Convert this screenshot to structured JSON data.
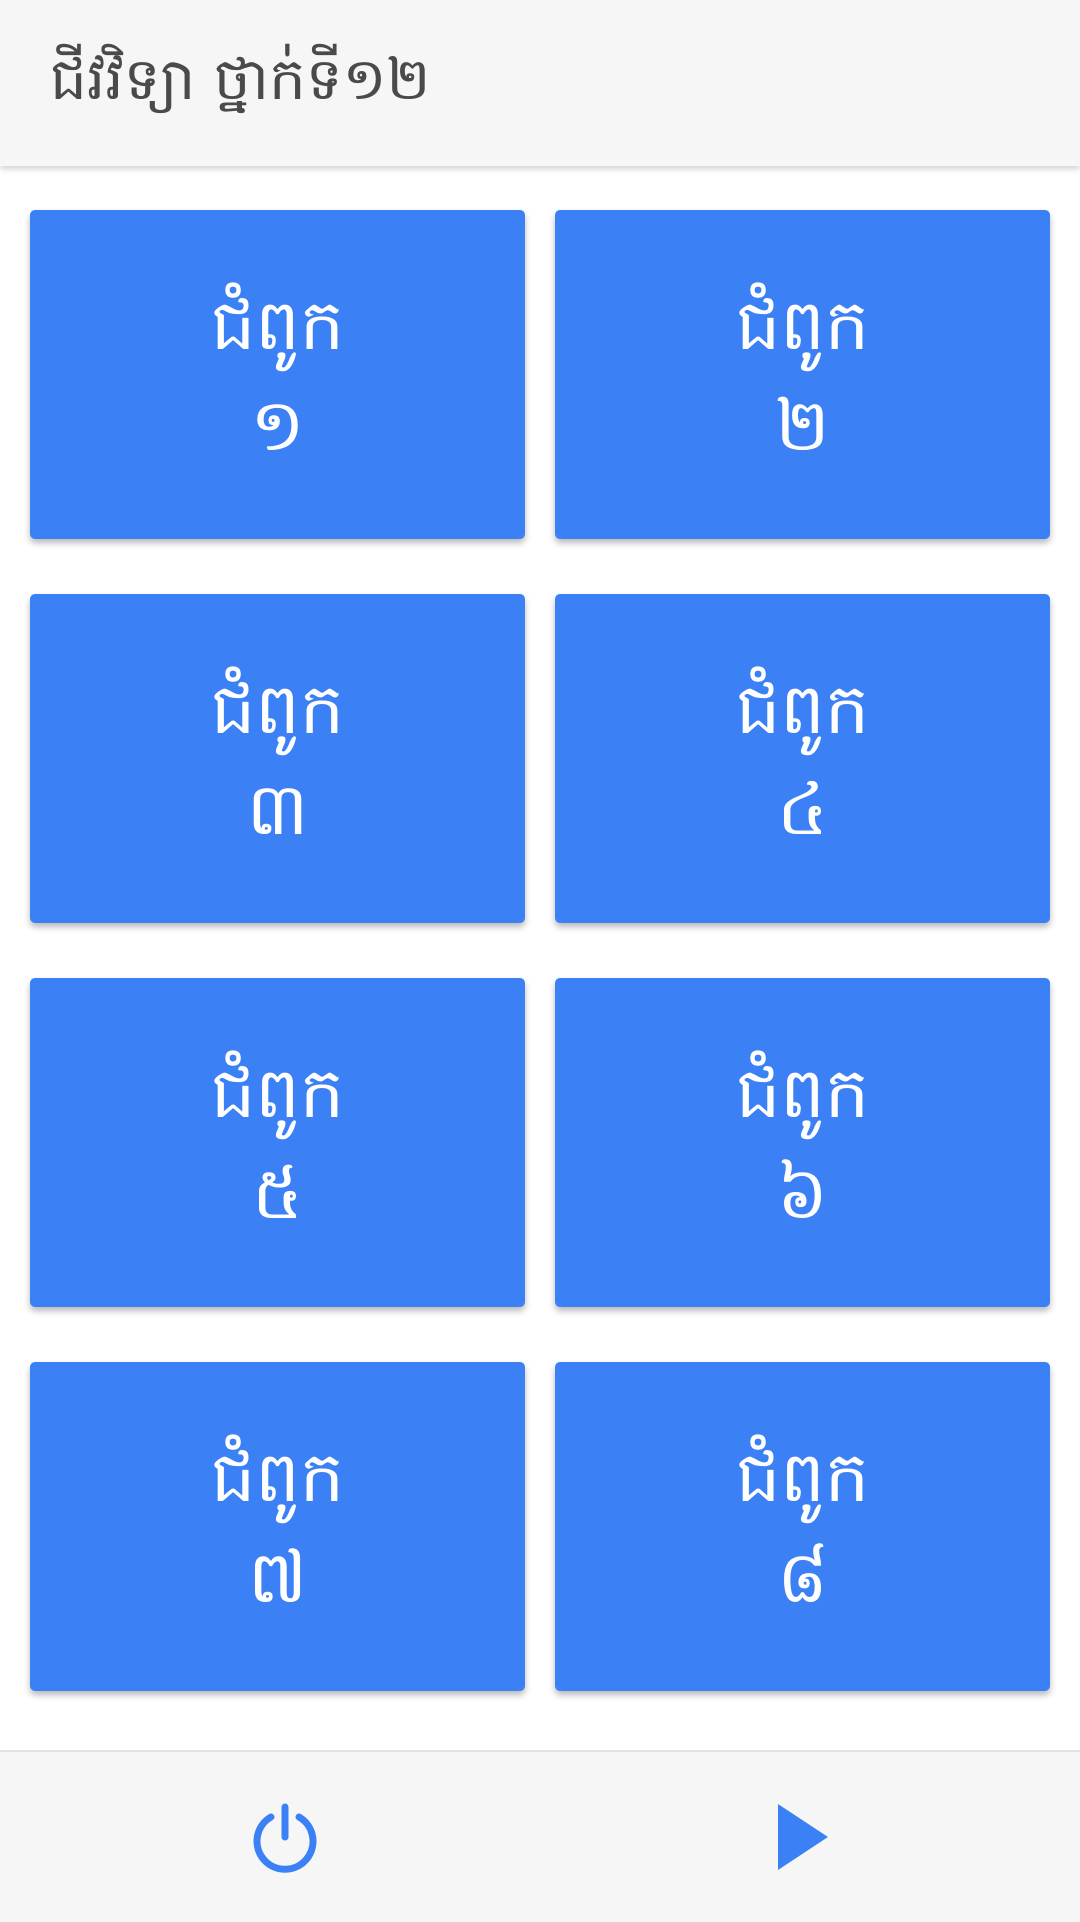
{
  "app_bar": {
    "title": "ជីវវិទ្យា ថ្នាក់ទី១២"
  },
  "chapters": [
    {
      "label": "ជំពូក",
      "number": "១"
    },
    {
      "label": "ជំពូក",
      "number": "២"
    },
    {
      "label": "ជំពូក",
      "number": "៣"
    },
    {
      "label": "ជំពូក",
      "number": "៤"
    },
    {
      "label": "ជំពូក",
      "number": "៥"
    },
    {
      "label": "ជំពូក",
      "number": "៦"
    },
    {
      "label": "ជំពូក",
      "number": "៧"
    },
    {
      "label": "ជំពូក",
      "number": "៨"
    }
  ],
  "bottom_bar": {
    "left_icon": "power-icon",
    "right_icon": "play-icon"
  },
  "colors": {
    "accent": "#3b80f4",
    "bar_background": "#f6f6f6",
    "title_text": "#4a4a4a",
    "card_text": "#ffffff"
  }
}
